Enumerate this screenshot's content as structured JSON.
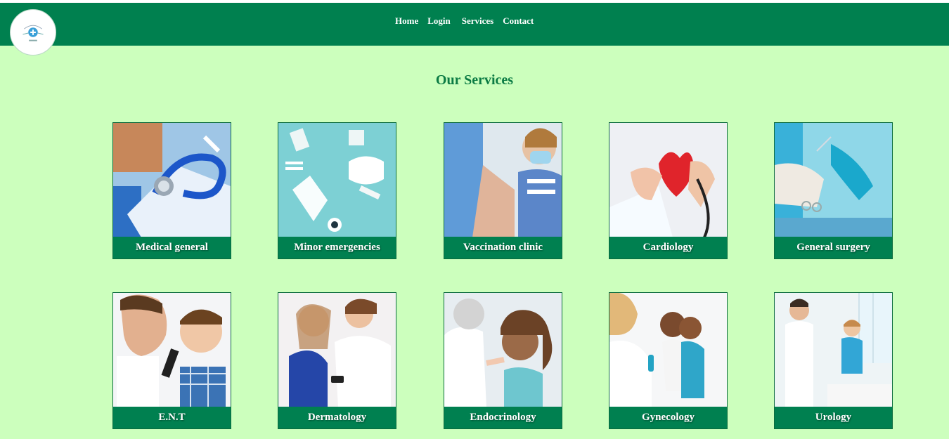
{
  "nav": {
    "items": [
      "Home",
      "Login",
      "Services",
      "Contact"
    ]
  },
  "page": {
    "title": "Our Services"
  },
  "services": [
    {
      "label": "Medical general",
      "icon": "stethoscope-icon"
    },
    {
      "label": "Minor emergencies",
      "icon": "mask-icon"
    },
    {
      "label": "Vaccination clinic",
      "icon": "vaccine-icon"
    },
    {
      "label": "Cardiology",
      "icon": "heart-icon"
    },
    {
      "label": "General surgery",
      "icon": "surgery-icon"
    },
    {
      "label": "E.N.T",
      "icon": "ear-icon"
    },
    {
      "label": "Dermatology",
      "icon": "skin-icon"
    },
    {
      "label": "Endocrinology",
      "icon": "thyroid-icon"
    },
    {
      "label": "Gynecology",
      "icon": "women-health-icon"
    },
    {
      "label": "Urology",
      "icon": "urology-icon"
    }
  ],
  "colors": {
    "background": "#ccffbd",
    "header": "#00804f",
    "title": "#0b7b44",
    "label_bg": "#008050"
  }
}
